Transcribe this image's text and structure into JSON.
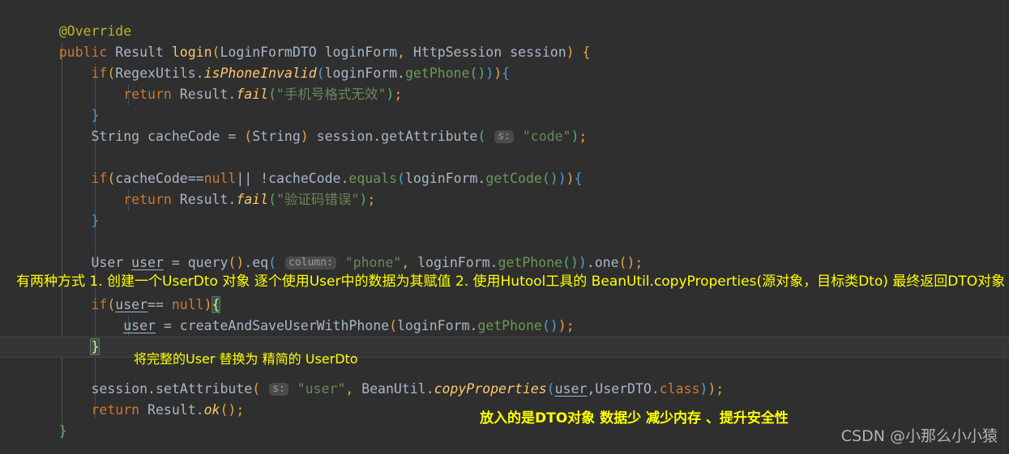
{
  "editor": {
    "theme": "darcula",
    "background": "#2f2f2f",
    "language": "java",
    "colors": {
      "keyword": "#cc7832",
      "annotation": "#bbb529",
      "string": "#6a8759",
      "method": "#ffc66d",
      "number": "#6897bb",
      "default_text": "#a9b7c6",
      "highlight_row": "#353535",
      "brace_match_bg": "#3b514d",
      "hint_bg": "#4b4b4b",
      "hint_text": "#9a9a9a",
      "annotation_overlay": "#ffff00"
    },
    "code_lines": [
      {
        "index": 1,
        "text": "    @Override",
        "tokens": [
          {
            "t": "    ",
            "c": "pn"
          },
          {
            "t": "@Override",
            "c": "ann"
          }
        ]
      },
      {
        "index": 2,
        "text": "    public Result login(LoginFormDTO loginForm, HttpSession session) {",
        "tokens": [
          {
            "t": "    ",
            "c": "pn"
          },
          {
            "t": "public",
            "c": "kw"
          },
          {
            "t": " ",
            "c": "pn"
          },
          {
            "t": "Result",
            "c": "cls"
          },
          {
            "t": " ",
            "c": "pn"
          },
          {
            "t": "login",
            "c": "mth"
          },
          {
            "t": "(",
            "c": "brk1"
          },
          {
            "t": "LoginFormDTO",
            "c": "cls"
          },
          {
            "t": " loginForm",
            "c": "pn"
          },
          {
            "t": ",",
            "c": "brk1"
          },
          {
            "t": " ",
            "c": "pn"
          },
          {
            "t": "HttpSession",
            "c": "cls"
          },
          {
            "t": " session",
            "c": "pn"
          },
          {
            "t": ")",
            "c": "brk1"
          },
          {
            "t": " ",
            "c": "pn"
          },
          {
            "t": "{",
            "c": "brk1"
          }
        ]
      },
      {
        "index": 3,
        "text": "        if(RegexUtils.isPhoneInvalid(loginForm.getPhone())){",
        "tokens": [
          {
            "t": "        ",
            "c": "pn"
          },
          {
            "t": "if",
            "c": "kw"
          },
          {
            "t": "(",
            "c": "brk1"
          },
          {
            "t": "RegexUtils",
            "c": "cls"
          },
          {
            "t": ".",
            "c": "pn"
          },
          {
            "t": "isPhoneInvalid",
            "c": "mthi"
          },
          {
            "t": "(",
            "c": "brk2"
          },
          {
            "t": "loginForm",
            "c": "pn"
          },
          {
            "t": ".",
            "c": "pn"
          },
          {
            "t": "getPhone",
            "c": "pgrn"
          },
          {
            "t": "(",
            "c": "brk3"
          },
          {
            "t": ")",
            "c": "brk3"
          },
          {
            "t": ")",
            "c": "brk2"
          },
          {
            "t": ")",
            "c": "brk1"
          },
          {
            "t": "{",
            "c": "brk2"
          }
        ]
      },
      {
        "index": 4,
        "text": "            return Result.fail(\"手机号格式无效\");",
        "tokens": [
          {
            "t": "            ",
            "c": "pn"
          },
          {
            "t": "return",
            "c": "kw"
          },
          {
            "t": " ",
            "c": "pn"
          },
          {
            "t": "Result",
            "c": "cls"
          },
          {
            "t": ".",
            "c": "pn"
          },
          {
            "t": "fail",
            "c": "mthi"
          },
          {
            "t": "(",
            "c": "brk3"
          },
          {
            "t": "\"手机号格式无效\"",
            "c": "str"
          },
          {
            "t": ")",
            "c": "brk3"
          },
          {
            "t": ";",
            "c": "brk1"
          }
        ]
      },
      {
        "index": 5,
        "text": "        }",
        "tokens": [
          {
            "t": "        ",
            "c": "pn"
          },
          {
            "t": "}",
            "c": "brk2"
          }
        ]
      },
      {
        "index": 6,
        "text": "        String cacheCode = (String) session.getAttribute( s: \"code\");",
        "tokens": [
          {
            "t": "        ",
            "c": "pn"
          },
          {
            "t": "String",
            "c": "cls"
          },
          {
            "t": " cacheCode ",
            "c": "pn"
          },
          {
            "t": "=",
            "c": "pn"
          },
          {
            "t": " ",
            "c": "pn"
          },
          {
            "t": "(",
            "c": "brk1"
          },
          {
            "t": "String",
            "c": "cls"
          },
          {
            "t": ")",
            "c": "brk1"
          },
          {
            "t": " session",
            "c": "pn"
          },
          {
            "t": ".",
            "c": "pn"
          },
          {
            "t": "getAttribute",
            "c": "pn"
          },
          {
            "t": "(",
            "c": "brk3"
          },
          {
            "t": " ",
            "c": "pn"
          },
          {
            "t": "s:",
            "c": "hint"
          },
          {
            "t": " ",
            "c": "pn"
          },
          {
            "t": "\"code\"",
            "c": "str"
          },
          {
            "t": ")",
            "c": "brk3"
          },
          {
            "t": ";",
            "c": "brk1"
          }
        ]
      },
      {
        "index": 7,
        "text": "",
        "tokens": []
      },
      {
        "index": 8,
        "text": "        if(cacheCode==null|| !cacheCode.equals(loginForm.getCode())){",
        "tokens": [
          {
            "t": "        ",
            "c": "pn"
          },
          {
            "t": "if",
            "c": "kw"
          },
          {
            "t": "(",
            "c": "brk1"
          },
          {
            "t": "cacheCode",
            "c": "pn"
          },
          {
            "t": "==",
            "c": "pn"
          },
          {
            "t": "null",
            "c": "kw"
          },
          {
            "t": "|| !",
            "c": "pn"
          },
          {
            "t": "cacheCode",
            "c": "pn"
          },
          {
            "t": ".",
            "c": "pn"
          },
          {
            "t": "equals",
            "c": "pgrn"
          },
          {
            "t": "(",
            "c": "brk2"
          },
          {
            "t": "loginForm",
            "c": "pn"
          },
          {
            "t": ".",
            "c": "pn"
          },
          {
            "t": "getCode",
            "c": "pgrn"
          },
          {
            "t": "(",
            "c": "brk3"
          },
          {
            "t": ")",
            "c": "brk3"
          },
          {
            "t": ")",
            "c": "brk2"
          },
          {
            "t": ")",
            "c": "brk1"
          },
          {
            "t": "{",
            "c": "brk2"
          }
        ]
      },
      {
        "index": 9,
        "text": "            return Result.fail(\"验证码错误\");",
        "tokens": [
          {
            "t": "            ",
            "c": "pn"
          },
          {
            "t": "return",
            "c": "kw"
          },
          {
            "t": " ",
            "c": "pn"
          },
          {
            "t": "Result",
            "c": "cls"
          },
          {
            "t": ".",
            "c": "pn"
          },
          {
            "t": "fail",
            "c": "mthi"
          },
          {
            "t": "(",
            "c": "brk3"
          },
          {
            "t": "\"验证码错误\"",
            "c": "str"
          },
          {
            "t": ")",
            "c": "brk3"
          },
          {
            "t": ";",
            "c": "brk1"
          }
        ]
      },
      {
        "index": 10,
        "text": "        }",
        "tokens": [
          {
            "t": "        ",
            "c": "pn"
          },
          {
            "t": "}",
            "c": "brk2"
          }
        ]
      },
      {
        "index": 11,
        "text": "",
        "tokens": []
      },
      {
        "index": 12,
        "text": "        User user = query().eq( column: \"phone\", loginForm.getPhone()).one();",
        "tokens": [
          {
            "t": "        ",
            "c": "pn"
          },
          {
            "t": "User",
            "c": "cls"
          },
          {
            "t": " ",
            "c": "pn"
          },
          {
            "t": "user",
            "c": "var"
          },
          {
            "t": " = ",
            "c": "pn"
          },
          {
            "t": "query",
            "c": "pn"
          },
          {
            "t": "(",
            "c": "brk1"
          },
          {
            "t": ")",
            "c": "brk1"
          },
          {
            "t": ".",
            "c": "pn"
          },
          {
            "t": "eq",
            "c": "pn"
          },
          {
            "t": "(",
            "c": "brk2"
          },
          {
            "t": " ",
            "c": "pn"
          },
          {
            "t": "column:",
            "c": "hint"
          },
          {
            "t": " ",
            "c": "pn"
          },
          {
            "t": "\"phone\"",
            "c": "str"
          },
          {
            "t": ",",
            "c": "brk1"
          },
          {
            "t": " loginForm",
            "c": "pn"
          },
          {
            "t": ".",
            "c": "pn"
          },
          {
            "t": "getPhone",
            "c": "pgrn"
          },
          {
            "t": "(",
            "c": "brk3"
          },
          {
            "t": ")",
            "c": "brk3"
          },
          {
            "t": ")",
            "c": "brk2"
          },
          {
            "t": ".",
            "c": "pn"
          },
          {
            "t": "one",
            "c": "pn"
          },
          {
            "t": "(",
            "c": "brk1"
          },
          {
            "t": ")",
            "c": "brk1"
          },
          {
            "t": ";",
            "c": "brk1"
          }
        ]
      },
      {
        "index": 13,
        "text": "",
        "tokens": []
      },
      {
        "index": 14,
        "text": "        if(user== null){",
        "tokens": [
          {
            "t": "        ",
            "c": "pn"
          },
          {
            "t": "if",
            "c": "kw"
          },
          {
            "t": "(",
            "c": "brk1"
          },
          {
            "t": "user",
            "c": "var"
          },
          {
            "t": "== ",
            "c": "pn"
          },
          {
            "t": "null",
            "c": "kw"
          },
          {
            "t": ")",
            "c": "brk1"
          },
          {
            "t": "{",
            "c": "brace-match"
          }
        ]
      },
      {
        "index": 15,
        "text": "            user = createAndSaveUserWithPhone(loginForm.getPhone());",
        "tokens": [
          {
            "t": "            ",
            "c": "pn"
          },
          {
            "t": "user",
            "c": "var"
          },
          {
            "t": " = ",
            "c": "pn"
          },
          {
            "t": "createAndSaveUserWithPhone",
            "c": "pn"
          },
          {
            "t": "(",
            "c": "brk1"
          },
          {
            "t": "loginForm",
            "c": "pn"
          },
          {
            "t": ".",
            "c": "pn"
          },
          {
            "t": "getPhone",
            "c": "pgrn"
          },
          {
            "t": "(",
            "c": "brk2"
          },
          {
            "t": ")",
            "c": "brk2"
          },
          {
            "t": ")",
            "c": "brk1"
          },
          {
            "t": ";",
            "c": "brk1"
          }
        ]
      },
      {
        "index": 16,
        "text": "        }",
        "highlighted": true,
        "tokens": [
          {
            "t": "        ",
            "c": "pn"
          },
          {
            "t": "}",
            "c": "brace-match"
          }
        ]
      },
      {
        "index": 17,
        "text": "",
        "tokens": []
      },
      {
        "index": 18,
        "text": "        session.setAttribute( s: \"user\", BeanUtil.copyProperties(user,UserDTO.class));",
        "tokens": [
          {
            "t": "        ",
            "c": "pn"
          },
          {
            "t": "session",
            "c": "pn"
          },
          {
            "t": ".",
            "c": "pn"
          },
          {
            "t": "setAttribute",
            "c": "pn"
          },
          {
            "t": "(",
            "c": "brk1"
          },
          {
            "t": " ",
            "c": "pn"
          },
          {
            "t": "s:",
            "c": "hint"
          },
          {
            "t": " ",
            "c": "pn"
          },
          {
            "t": "\"user\"",
            "c": "str"
          },
          {
            "t": ",",
            "c": "brk1"
          },
          {
            "t": " ",
            "c": "pn"
          },
          {
            "t": "BeanUtil",
            "c": "cls"
          },
          {
            "t": ".",
            "c": "pn"
          },
          {
            "t": "copyProperties",
            "c": "mthi"
          },
          {
            "t": "(",
            "c": "brk2"
          },
          {
            "t": "user",
            "c": "var"
          },
          {
            "t": ",",
            "c": "pn"
          },
          {
            "t": "UserDTO",
            "c": "cls"
          },
          {
            "t": ".",
            "c": "pn"
          },
          {
            "t": "class",
            "c": "kw"
          },
          {
            "t": ")",
            "c": "brk2"
          },
          {
            "t": ")",
            "c": "brk1"
          },
          {
            "t": ";",
            "c": "brk1"
          }
        ]
      },
      {
        "index": 19,
        "text": "        return Result.ok();",
        "tokens": [
          {
            "t": "        ",
            "c": "pn"
          },
          {
            "t": "return",
            "c": "kw"
          },
          {
            "t": " ",
            "c": "pn"
          },
          {
            "t": "Result",
            "c": "cls"
          },
          {
            "t": ".",
            "c": "pn"
          },
          {
            "t": "ok",
            "c": "mthi"
          },
          {
            "t": "(",
            "c": "brk1"
          },
          {
            "t": ")",
            "c": "brk1"
          },
          {
            "t": ";",
            "c": "brk1"
          }
        ]
      },
      {
        "index": 20,
        "text": "    }",
        "tokens": [
          {
            "t": "    ",
            "c": "pn"
          },
          {
            "t": "}",
            "c": "brk3"
          }
        ]
      }
    ]
  },
  "annotations": [
    {
      "id": "anno-dto-ways",
      "text": "有两种方式 1. 创建一个UserDto 对象 逐个使用User中的数据为其赋值  2. 使用Hutool工具的 BeanUtil.copyProperties(源对象，目标类Dto) 最终返回DTO对象"
    },
    {
      "id": "anno-replace-user",
      "text": "将完整的User 替换为 精简的 UserDto"
    },
    {
      "id": "anno-dto-benefit",
      "text": "放入的是DTO对象 数据少 减少内存 、提升安全性"
    }
  ],
  "watermark": {
    "text": "CSDN @小那么小小猿"
  }
}
